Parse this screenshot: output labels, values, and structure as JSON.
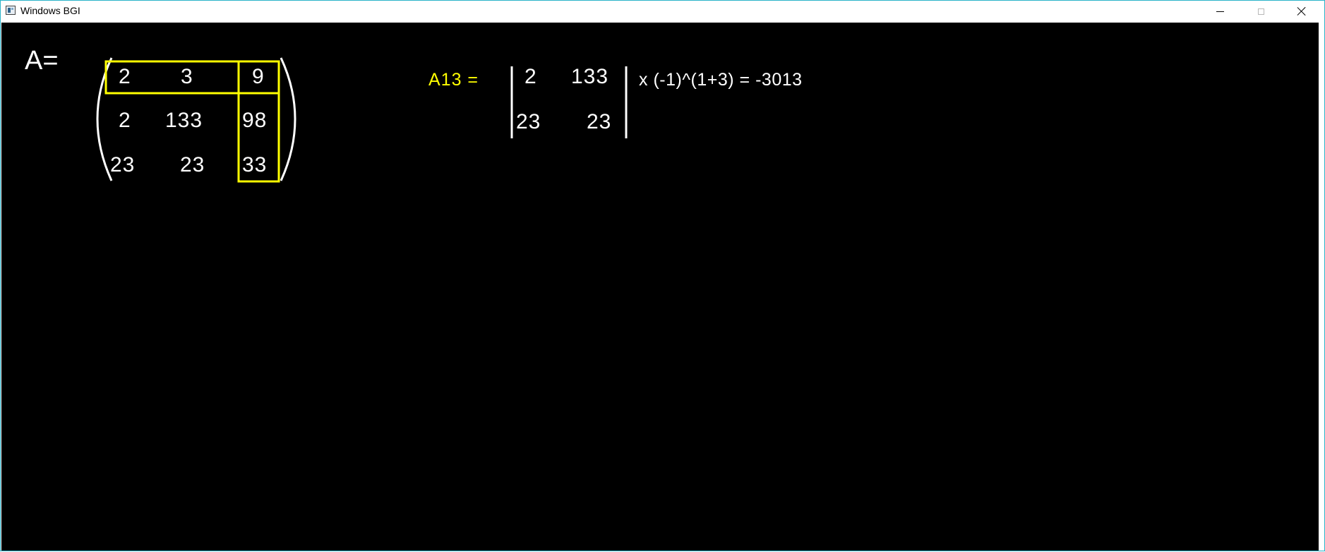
{
  "window": {
    "title": "Windows BGI",
    "controls": {
      "minimize_icon": "minimize-icon",
      "maximize_icon": "maximize-icon",
      "close_icon": "close-icon"
    }
  },
  "matrix": {
    "label": "A=",
    "rows": [
      [
        "2",
        "3",
        "9"
      ],
      [
        "2",
        "133",
        "98"
      ],
      [
        "23",
        "23",
        "33"
      ]
    ],
    "highlight": {
      "row": 1,
      "column": 3
    }
  },
  "minor": {
    "label": "A13 =",
    "rows": [
      [
        "2",
        "133"
      ],
      [
        "23",
        "23"
      ]
    ],
    "expression": "x (-1)^(1+3) = -3013"
  },
  "colors": {
    "background": "#000000",
    "text": "#ffffff",
    "highlight": "#ffff00",
    "window_border": "#2ab3c9"
  }
}
